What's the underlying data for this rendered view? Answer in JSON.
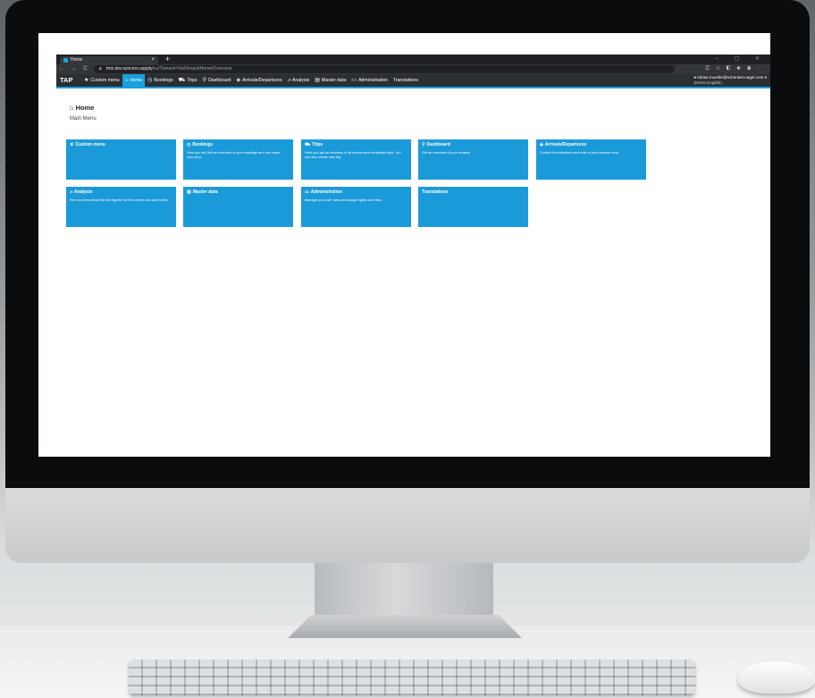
{
  "browser": {
    "tab_title": "Home",
    "tab_close": "×",
    "new_tab": "+",
    "nav_buttons": "← → C",
    "url_host": "tms.dev.syncers.supply",
    "url_path": "/cu/?tenant=TestTenant/Home/Overview",
    "icons": [
      "key-icon",
      "star-icon",
      "extension-icon",
      "puzzle-icon",
      "profile-icon",
      "menu-icon"
    ]
  },
  "app": {
    "brand": "TAP",
    "nav": [
      {
        "icon": "★",
        "label": "Custom menu"
      },
      {
        "icon": "⌂",
        "label": "Home"
      },
      {
        "icon": "◷",
        "label": "Bookings"
      },
      {
        "icon": "⛟",
        "label": "Trips"
      },
      {
        "icon": "⚲",
        "label": "Dashboard"
      },
      {
        "icon": "◈",
        "label": "Arrivals/Departures"
      },
      {
        "icon": "⩘",
        "label": "Analysis"
      },
      {
        "icon": "▤",
        "label": "Master data"
      },
      {
        "icon": "▭",
        "label": "Administration"
      },
      {
        "icon": "",
        "label": "Translations"
      }
    ],
    "active_nav": "Home",
    "user": {
      "email": "tobias.mueller@schenker.nagel.com",
      "sub": "(Demo English)"
    }
  },
  "page": {
    "heading_icon": "⌂",
    "heading": "Home",
    "subheading": "Main Menu"
  },
  "tiles": [
    {
      "icon": "★",
      "title": "Custom menu",
      "desc": ""
    },
    {
      "icon": "◷",
      "title": "Bookings",
      "desc": "Here you will find an overview of your bookings and can make new ones."
    },
    {
      "icon": "⛟",
      "title": "Trips",
      "desc": "Here you get an overview of all current and completed trips. You can also create new trip."
    },
    {
      "icon": "⚲",
      "title": "Dashboard",
      "desc": "Get an overview of your location"
    },
    {
      "icon": "◈",
      "title": "Arrivals/Departures",
      "desc": "Control the entrances and exits of your location here."
    },
    {
      "icon": "⩘",
      "title": "Analysis",
      "desc": "Find out here about the key figures for the current and last month."
    },
    {
      "icon": "▤",
      "title": "Master data",
      "desc": ""
    },
    {
      "icon": "▭",
      "title": "Administration",
      "desc": "Manage your user data and assign rights and roles."
    },
    {
      "icon": "",
      "title": "Translations",
      "desc": ""
    }
  ],
  "colors": {
    "accent": "#1b9ad9",
    "navbar": "#2b2e33",
    "browser_chrome": "#202124"
  }
}
